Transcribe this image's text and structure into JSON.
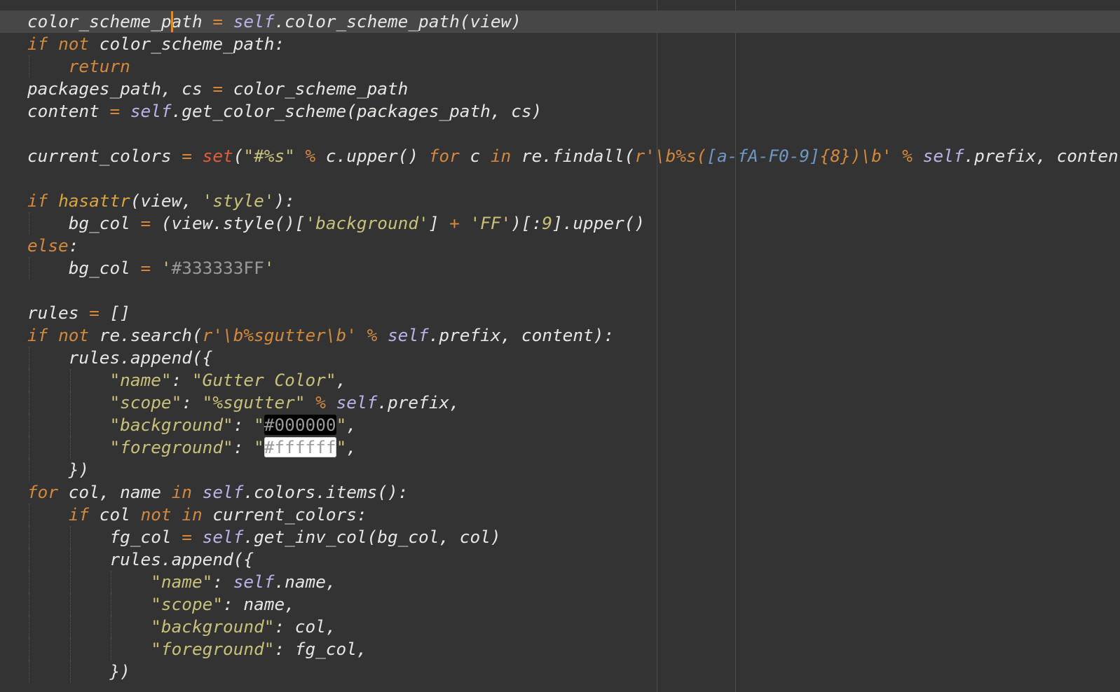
{
  "editor": {
    "language": "python",
    "cursor": {
      "line": 1,
      "column": 14
    },
    "colors": {
      "background": "#333333",
      "current_line": "#474747",
      "caret": "#e08a2e",
      "keyword": "#d3893d",
      "self": "#b9b4e8",
      "builtin": "#e25b3b",
      "string": "#c9c07a",
      "regex_class": "#6f97c5",
      "text": "#e8e6e3"
    },
    "lines": [
      {
        "current": true,
        "caret_col": 14,
        "indent": 0,
        "tokens": [
          {
            "t": "color_scheme_path ",
            "c": "txt"
          },
          {
            "t": "=",
            "c": "op"
          },
          {
            "t": " ",
            "c": "txt"
          },
          {
            "t": "self",
            "c": "slf"
          },
          {
            "t": ".color_scheme_path(view)",
            "c": "txt"
          }
        ]
      },
      {
        "indent": 0,
        "tokens": [
          {
            "t": "if",
            "c": "kw"
          },
          {
            "t": " ",
            "c": "txt"
          },
          {
            "t": "not",
            "c": "kw"
          },
          {
            "t": " color_scheme_path:",
            "c": "txt"
          }
        ]
      },
      {
        "indent": 1,
        "tokens": [
          {
            "t": "    ",
            "c": "txt"
          },
          {
            "t": "return",
            "c": "kw"
          }
        ]
      },
      {
        "indent": 0,
        "tokens": [
          {
            "t": "packages_path, cs ",
            "c": "txt"
          },
          {
            "t": "=",
            "c": "op"
          },
          {
            "t": " color_scheme_path",
            "c": "txt"
          }
        ]
      },
      {
        "indent": 0,
        "tokens": [
          {
            "t": "content ",
            "c": "txt"
          },
          {
            "t": "=",
            "c": "op"
          },
          {
            "t": " ",
            "c": "txt"
          },
          {
            "t": "self",
            "c": "slf"
          },
          {
            "t": ".get_color_scheme(packages_path, cs)",
            "c": "txt"
          }
        ]
      },
      {
        "indent": 0,
        "tokens": []
      },
      {
        "indent": 0,
        "tokens": [
          {
            "t": "current_colors ",
            "c": "txt"
          },
          {
            "t": "=",
            "c": "op"
          },
          {
            "t": " ",
            "c": "txt"
          },
          {
            "t": "set",
            "c": "bi"
          },
          {
            "t": "(",
            "c": "txt"
          },
          {
            "t": "\"#%s\"",
            "c": "strk"
          },
          {
            "t": " ",
            "c": "txt"
          },
          {
            "t": "%",
            "c": "op"
          },
          {
            "t": " c.upper() ",
            "c": "txt"
          },
          {
            "t": "for",
            "c": "kw"
          },
          {
            "t": " c ",
            "c": "txt"
          },
          {
            "t": "in",
            "c": "kw"
          },
          {
            "t": " re.findall(",
            "c": "txt"
          },
          {
            "t": "r'\\b%s(",
            "c": "rx"
          },
          {
            "t": "[a-fA-F0-9]",
            "c": "rxc"
          },
          {
            "t": "{8}",
            "c": "rx"
          },
          {
            "t": ")\\b'",
            "c": "rx"
          },
          {
            "t": " ",
            "c": "txt"
          },
          {
            "t": "%",
            "c": "op"
          },
          {
            "t": " ",
            "c": "txt"
          },
          {
            "t": "self",
            "c": "slf"
          },
          {
            "t": ".prefix, content))",
            "c": "txt"
          }
        ]
      },
      {
        "indent": 0,
        "tokens": []
      },
      {
        "indent": 0,
        "tokens": [
          {
            "t": "if",
            "c": "kw"
          },
          {
            "t": " ",
            "c": "txt"
          },
          {
            "t": "hasattr",
            "c": "fn"
          },
          {
            "t": "(view, ",
            "c": "txt"
          },
          {
            "t": "'style'",
            "c": "str"
          },
          {
            "t": "):",
            "c": "txt"
          }
        ]
      },
      {
        "indent": 1,
        "tokens": [
          {
            "t": "    bg_col ",
            "c": "txt"
          },
          {
            "t": "=",
            "c": "op"
          },
          {
            "t": " (view.style()[",
            "c": "txt"
          },
          {
            "t": "'background'",
            "c": "str"
          },
          {
            "t": "] ",
            "c": "txt"
          },
          {
            "t": "+",
            "c": "op"
          },
          {
            "t": " ",
            "c": "txt"
          },
          {
            "t": "'FF'",
            "c": "str"
          },
          {
            "t": ")[:",
            "c": "txt"
          },
          {
            "t": "9",
            "c": "num"
          },
          {
            "t": "].upper()",
            "c": "txt"
          }
        ]
      },
      {
        "indent": 0,
        "tokens": [
          {
            "t": "else",
            "c": "kw"
          },
          {
            "t": ":",
            "c": "txt"
          }
        ]
      },
      {
        "indent": 1,
        "tokens": [
          {
            "t": "    bg_col ",
            "c": "txt"
          },
          {
            "t": "=",
            "c": "op"
          },
          {
            "t": " ",
            "c": "txt"
          },
          {
            "t": "'",
            "c": "str"
          },
          {
            "t": "#333333FF",
            "c": "swatch sw-dark"
          },
          {
            "t": "'",
            "c": "str"
          }
        ]
      },
      {
        "indent": 0,
        "tokens": []
      },
      {
        "indent": 0,
        "tokens": [
          {
            "t": "rules ",
            "c": "txt"
          },
          {
            "t": "=",
            "c": "op"
          },
          {
            "t": " []",
            "c": "txt"
          }
        ]
      },
      {
        "indent": 0,
        "tokens": [
          {
            "t": "if",
            "c": "kw"
          },
          {
            "t": " ",
            "c": "txt"
          },
          {
            "t": "not",
            "c": "kw"
          },
          {
            "t": " re.search(",
            "c": "txt"
          },
          {
            "t": "r'\\b%sgutter\\b'",
            "c": "rx"
          },
          {
            "t": " ",
            "c": "txt"
          },
          {
            "t": "%",
            "c": "op"
          },
          {
            "t": " ",
            "c": "txt"
          },
          {
            "t": "self",
            "c": "slf"
          },
          {
            "t": ".prefix, content):",
            "c": "txt"
          }
        ]
      },
      {
        "indent": 1,
        "tokens": [
          {
            "t": "    rules.append({",
            "c": "txt"
          }
        ]
      },
      {
        "indent": 2,
        "tokens": [
          {
            "t": "        ",
            "c": "txt"
          },
          {
            "t": "\"name\"",
            "c": "strk"
          },
          {
            "t": ": ",
            "c": "txt"
          },
          {
            "t": "\"Gutter Color\"",
            "c": "strk"
          },
          {
            "t": ",",
            "c": "txt"
          }
        ]
      },
      {
        "indent": 2,
        "tokens": [
          {
            "t": "        ",
            "c": "txt"
          },
          {
            "t": "\"scope\"",
            "c": "strk"
          },
          {
            "t": ": ",
            "c": "txt"
          },
          {
            "t": "\"%sgutter\"",
            "c": "strk"
          },
          {
            "t": " ",
            "c": "txt"
          },
          {
            "t": "%",
            "c": "op"
          },
          {
            "t": " ",
            "c": "txt"
          },
          {
            "t": "self",
            "c": "slf"
          },
          {
            "t": ".prefix,",
            "c": "txt"
          }
        ]
      },
      {
        "indent": 2,
        "tokens": [
          {
            "t": "        ",
            "c": "txt"
          },
          {
            "t": "\"background\"",
            "c": "strk"
          },
          {
            "t": ": ",
            "c": "txt"
          },
          {
            "t": "\"",
            "c": "strk"
          },
          {
            "t": "#000000",
            "c": "swatch sw-black"
          },
          {
            "t": "\"",
            "c": "strk"
          },
          {
            "t": ",",
            "c": "txt"
          }
        ]
      },
      {
        "indent": 2,
        "tokens": [
          {
            "t": "        ",
            "c": "txt"
          },
          {
            "t": "\"foreground\"",
            "c": "strk"
          },
          {
            "t": ": ",
            "c": "txt"
          },
          {
            "t": "\"",
            "c": "strk"
          },
          {
            "t": "#ffffff",
            "c": "swatch sw-white"
          },
          {
            "t": "\"",
            "c": "strk"
          },
          {
            "t": ",",
            "c": "txt"
          }
        ]
      },
      {
        "indent": 1,
        "tokens": [
          {
            "t": "    })",
            "c": "txt"
          }
        ]
      },
      {
        "indent": 0,
        "tokens": [
          {
            "t": "for",
            "c": "kw"
          },
          {
            "t": " col, name ",
            "c": "txt"
          },
          {
            "t": "in",
            "c": "kw"
          },
          {
            "t": " ",
            "c": "txt"
          },
          {
            "t": "self",
            "c": "slf"
          },
          {
            "t": ".colors.items():",
            "c": "txt"
          }
        ]
      },
      {
        "indent": 1,
        "tokens": [
          {
            "t": "    ",
            "c": "txt"
          },
          {
            "t": "if",
            "c": "kw"
          },
          {
            "t": " col ",
            "c": "txt"
          },
          {
            "t": "not",
            "c": "kw"
          },
          {
            "t": " ",
            "c": "txt"
          },
          {
            "t": "in",
            "c": "kw"
          },
          {
            "t": " current_colors:",
            "c": "txt"
          }
        ]
      },
      {
        "indent": 2,
        "tokens": [
          {
            "t": "        fg_col ",
            "c": "txt"
          },
          {
            "t": "=",
            "c": "op"
          },
          {
            "t": " ",
            "c": "txt"
          },
          {
            "t": "self",
            "c": "slf"
          },
          {
            "t": ".get_inv_col(bg_col, col)",
            "c": "txt"
          }
        ]
      },
      {
        "indent": 2,
        "tokens": [
          {
            "t": "        rules.append({",
            "c": "txt"
          }
        ]
      },
      {
        "indent": 3,
        "tokens": [
          {
            "t": "            ",
            "c": "txt"
          },
          {
            "t": "\"name\"",
            "c": "strk"
          },
          {
            "t": ": ",
            "c": "txt"
          },
          {
            "t": "self",
            "c": "slf"
          },
          {
            "t": ".name,",
            "c": "txt"
          }
        ]
      },
      {
        "indent": 3,
        "tokens": [
          {
            "t": "            ",
            "c": "txt"
          },
          {
            "t": "\"scope\"",
            "c": "strk"
          },
          {
            "t": ": name,",
            "c": "txt"
          }
        ]
      },
      {
        "indent": 3,
        "tokens": [
          {
            "t": "            ",
            "c": "txt"
          },
          {
            "t": "\"background\"",
            "c": "strk"
          },
          {
            "t": ": col,",
            "c": "txt"
          }
        ]
      },
      {
        "indent": 3,
        "tokens": [
          {
            "t": "            ",
            "c": "txt"
          },
          {
            "t": "\"foreground\"",
            "c": "strk"
          },
          {
            "t": ": fg_col,",
            "c": "txt"
          }
        ]
      },
      {
        "indent": 2,
        "tokens": [
          {
            "t": "        })",
            "c": "txt"
          }
        ]
      }
    ]
  }
}
